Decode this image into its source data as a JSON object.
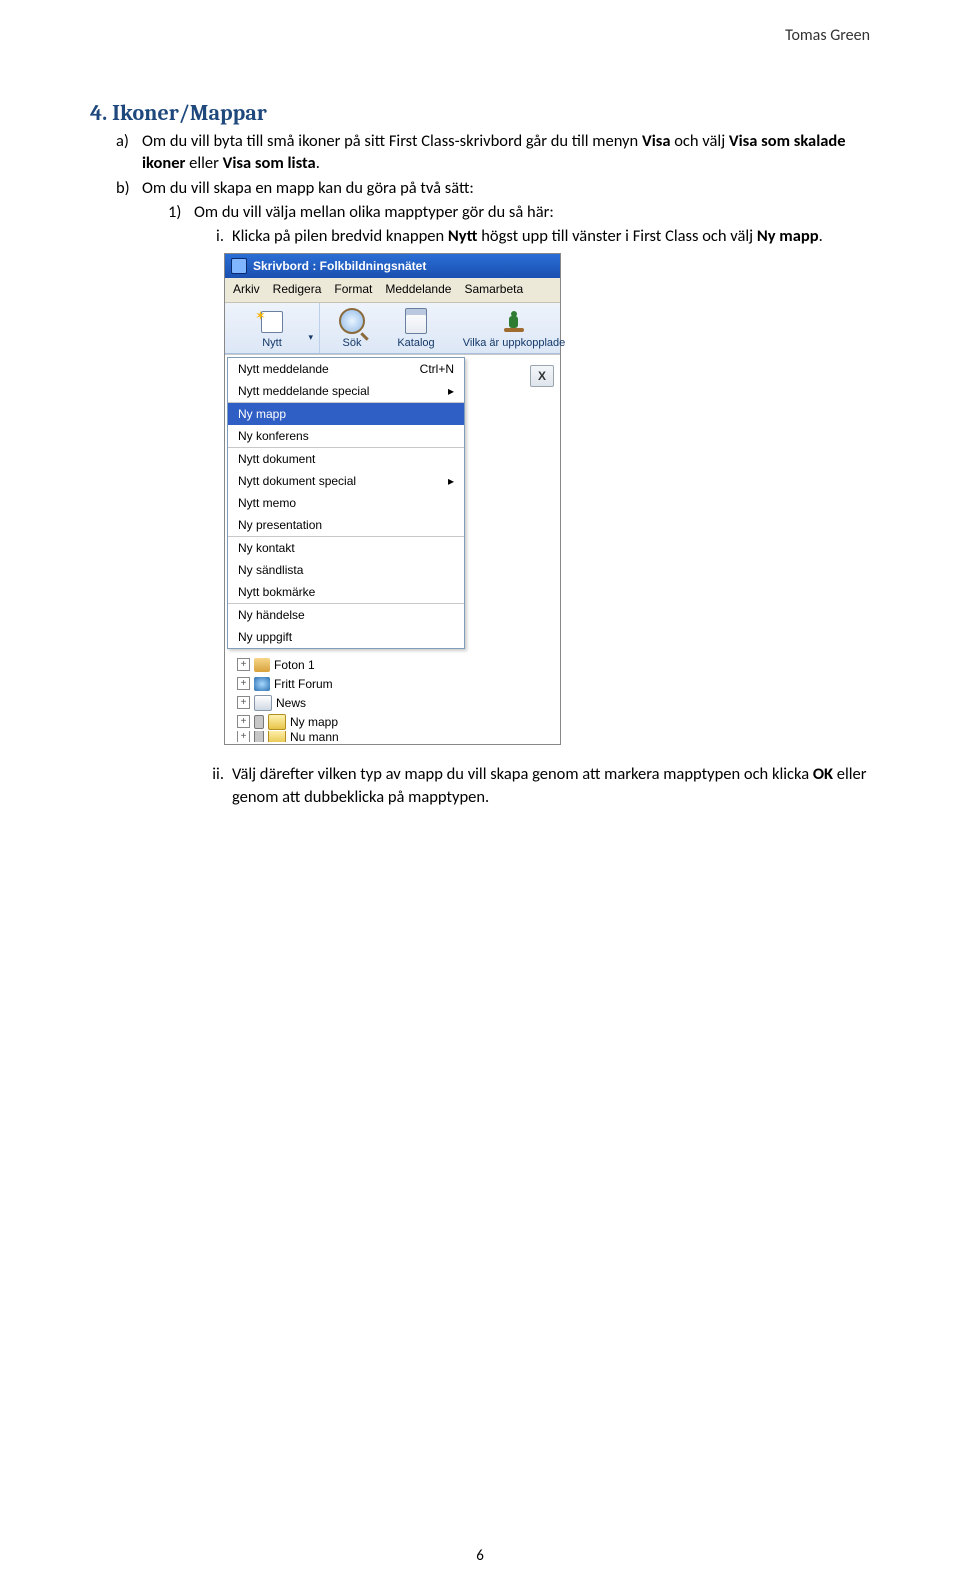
{
  "header_name": "Tomas Green",
  "section_title": "4. Ikoner/Mappar",
  "list": {
    "a_label": "a)",
    "a_text_pre": "Om du vill byta till små ikoner på sitt First Class-skrivbord går du till menyn ",
    "a_bold1": "Visa",
    "a_text_mid": " och välj ",
    "a_bold2": "Visa som skalade ikoner",
    "a_text_mid2": " eller ",
    "a_bold3": "Visa som lista",
    "a_text_end": ".",
    "b_label": "b)",
    "b_text": "Om du vill skapa en mapp kan du göra på två sätt:",
    "one_label": "1)",
    "one_text": "Om du vill välja mellan olika mapptyper gör du så här:",
    "i_label": "i.",
    "i_text_pre": "Klicka på pilen bredvid knappen ",
    "i_bold1": "Nytt",
    "i_text_mid": " högst upp till vänster i First Class och välj ",
    "i_bold2": "Ny mapp",
    "i_text_end": ".",
    "ii_label": "ii.",
    "ii_text_pre": "Välj därefter vilken typ av mapp du vill skapa genom att markera mapptypen och klicka ",
    "ii_bold1": "OK",
    "ii_text_end": " eller genom att dubbeklicka på mapptypen."
  },
  "shot": {
    "title": "Skrivbord : Folkbildningsnätet",
    "menubar": [
      "Arkiv",
      "Redigera",
      "Format",
      "Meddelande",
      "Samarbeta"
    ],
    "toolbar": {
      "nytt": "Nytt",
      "sok": "Sök",
      "katalog": "Katalog",
      "uppkopplade": "Vilka är uppkopplade"
    },
    "close_btn": "X",
    "menu": {
      "g1": [
        {
          "label": "Nytt meddelande",
          "kb": "Ctrl+N"
        },
        {
          "label": "Nytt meddelande special",
          "sub": true
        }
      ],
      "g2": [
        {
          "label": "Ny mapp",
          "selected": true
        },
        {
          "label": "Ny konferens"
        }
      ],
      "g3": [
        {
          "label": "Nytt dokument"
        },
        {
          "label": "Nytt dokument special",
          "sub": true
        },
        {
          "label": "Nytt memo"
        },
        {
          "label": "Ny presentation"
        }
      ],
      "g4": [
        {
          "label": "Ny kontakt"
        },
        {
          "label": "Ny sändlista"
        },
        {
          "label": "Nytt bokmärke"
        }
      ],
      "g5": [
        {
          "label": "Ny händelse"
        },
        {
          "label": "Ny uppgift"
        }
      ]
    },
    "tree": [
      {
        "label": "Foton 1",
        "icon": "img"
      },
      {
        "label": "Fritt Forum",
        "icon": "globe"
      },
      {
        "label": "News",
        "icon": "news"
      },
      {
        "label": "Ny mapp",
        "icon": "fold",
        "lock": true
      },
      {
        "label": "Nu mann",
        "icon": "fold",
        "lock": true,
        "cut": true
      }
    ]
  },
  "page_number": "6"
}
